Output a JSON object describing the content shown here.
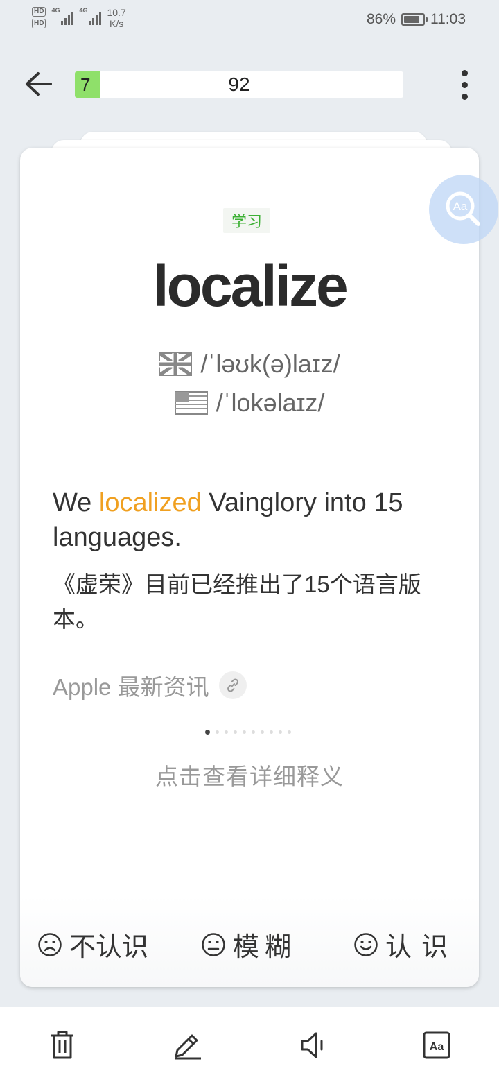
{
  "status_bar": {
    "hd1": "HD",
    "hd2": "HD",
    "net1": "4G",
    "net2": "4G",
    "speed_value": "10.7",
    "speed_unit": "K/s",
    "battery": "86%",
    "battery_level": 0.86,
    "time": "11:03"
  },
  "header": {
    "progress_current": "7",
    "progress_total": "92",
    "progress_fraction": 0.076
  },
  "card": {
    "tag": "学习",
    "word": "localize",
    "phonetic_uk": "/ˈləʊk(ə)laɪz/",
    "phonetic_us": "/ˈlokəlaɪz/",
    "sentence_before": "We ",
    "sentence_highlight": "localized",
    "sentence_after": " Vainglory into 15 languages.",
    "translation": "《虚荣》目前已经推出了15个语言版本。",
    "source": "Apple 最新资讯",
    "pager_total": 10,
    "pager_active": 0,
    "detail_hint": "点击查看详细释义"
  },
  "answers": {
    "unknown": "不认识",
    "vague": "模糊",
    "known": "认识"
  },
  "icons": {
    "back": "arrow-left-icon",
    "more": "more-vertical-icon",
    "translate": "translate-search-icon",
    "link": "link-icon",
    "delete": "trash-icon",
    "edit": "pencil-icon",
    "sound": "speaker-icon",
    "font": "font-size-icon"
  },
  "colors": {
    "progress_green": "#8fe06a",
    "tag_green": "#3cb034",
    "highlight_orange": "#f0a020",
    "background": "#e9edf1"
  }
}
